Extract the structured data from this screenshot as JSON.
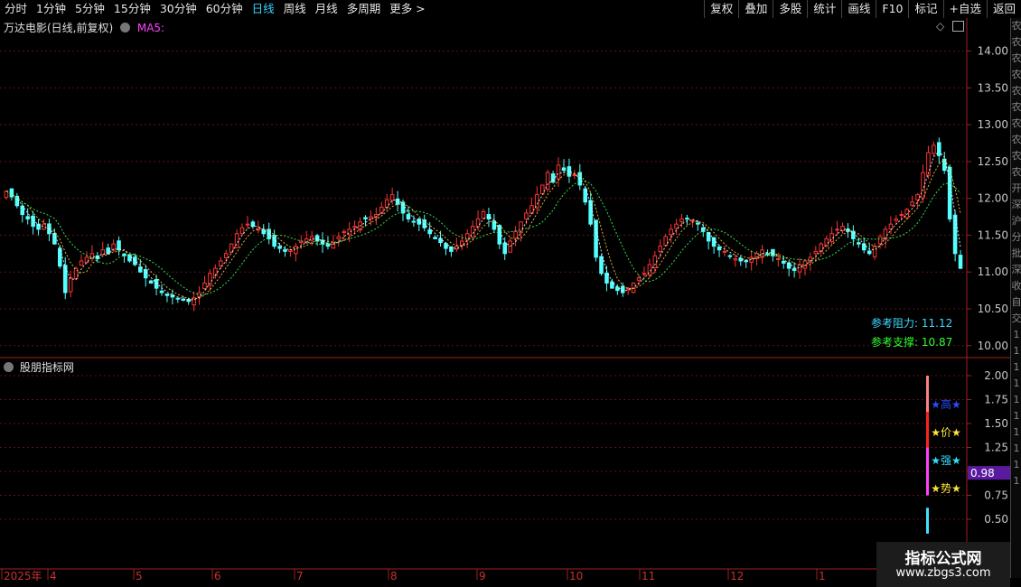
{
  "toolbar": {
    "periods": [
      "分时",
      "1分钟",
      "5分钟",
      "15分钟",
      "30分钟",
      "60分钟",
      "日线",
      "周线",
      "月线",
      "多周期",
      "更多 >"
    ],
    "active_period": "日线",
    "buttons": [
      "复权",
      "叠加",
      "多股",
      "统计",
      "画线",
      "F10",
      "标记",
      "+自选",
      "返回"
    ]
  },
  "side_strip": [
    "农",
    "农",
    "农",
    "农",
    "农",
    "农",
    "农",
    "农",
    "农",
    "农",
    "开",
    "深",
    "沪",
    "分",
    "批",
    "深",
    "收",
    "自",
    "交",
    "1",
    "1",
    "1",
    "1",
    "1",
    "1",
    "1",
    "1",
    "1",
    "1"
  ],
  "main_panel": {
    "title": "万达电影(日线,前复权)",
    "indicator": "MA5:",
    "price_ticks": [
      "14.00",
      "13.50",
      "13.00",
      "12.50",
      "12.00",
      "11.50",
      "11.00",
      "10.50",
      "10.00"
    ],
    "resistance_label": "参考阻力:",
    "resistance_value": "11.12",
    "support_label": "参考支撑:",
    "support_value": "10.87"
  },
  "sub_panel": {
    "title": "股朋指标网",
    "ticks": [
      "2.00",
      "1.75",
      "1.50",
      "1.25",
      "1.00",
      "0.75",
      "0.50"
    ],
    "labels": [
      {
        "text": "★高★",
        "color": "#2a4bff"
      },
      {
        "text": "★价★",
        "color": "#ffe23a"
      },
      {
        "text": "★强★",
        "color": "#33e0ff"
      },
      {
        "text": "★势★",
        "color": "#ffe23a"
      }
    ],
    "current_value": "0.98"
  },
  "time_axis": [
    "2025年",
    "4",
    "5",
    "6",
    "7",
    "8",
    "9",
    "10",
    "11",
    "12",
    "1"
  ],
  "watermark": {
    "line1": "指标公式网",
    "line2": "www.zbgs3.com"
  },
  "chart_data": {
    "type": "candlestick",
    "ylim": [
      9.85,
      14.3
    ],
    "colors": {
      "up": "#ff3232",
      "down": "#54ffff"
    },
    "close_series": [
      12.1,
      12.02,
      11.9,
      11.78,
      11.72,
      11.62,
      11.58,
      11.65,
      11.52,
      11.38,
      11.08,
      10.72,
      10.92,
      11.05,
      11.15,
      11.2,
      11.25,
      11.18,
      11.3,
      11.25,
      11.38,
      11.3,
      11.22,
      11.15,
      11.1,
      11.0,
      10.92,
      10.85,
      10.78,
      10.72,
      10.68,
      10.66,
      10.64,
      10.62,
      10.6,
      10.65,
      10.72,
      10.85,
      10.98,
      11.05,
      11.15,
      11.25,
      11.38,
      11.52,
      11.6,
      11.65,
      11.62,
      11.58,
      11.52,
      11.45,
      11.35,
      11.32,
      11.28,
      11.3,
      11.35,
      11.42,
      11.45,
      11.48,
      11.42,
      11.38,
      11.35,
      11.4,
      11.48,
      11.55,
      11.58,
      11.62,
      11.68,
      11.72,
      11.75,
      11.78,
      11.88,
      11.98,
      12.05,
      11.92,
      11.8,
      11.72,
      11.68,
      11.65,
      11.6,
      11.52,
      11.45,
      11.4,
      11.32,
      11.28,
      11.35,
      11.42,
      11.52,
      11.62,
      11.72,
      11.82,
      11.72,
      11.58,
      11.38,
      11.25,
      11.42,
      11.55,
      11.68,
      11.8,
      11.9,
      12.05,
      12.18,
      12.35,
      12.22,
      12.45,
      12.38,
      12.3,
      12.32,
      12.18,
      11.95,
      11.65,
      11.2,
      10.98,
      10.85,
      10.78,
      10.75,
      10.72,
      10.78,
      10.85,
      10.92,
      10.98,
      11.1,
      11.22,
      11.35,
      11.48,
      11.58,
      11.65,
      11.72,
      11.72,
      11.7,
      11.65,
      11.55,
      11.42,
      11.35,
      11.3,
      11.28,
      11.22,
      11.18,
      11.15,
      11.15,
      11.2,
      11.25,
      11.3,
      11.25,
      11.22,
      11.18,
      11.12,
      11.05,
      11.02,
      11.1,
      11.15,
      11.2,
      11.28,
      11.38,
      11.45,
      11.52,
      11.58,
      11.62,
      11.55,
      11.45,
      11.38,
      11.3,
      11.25,
      11.35,
      11.48,
      11.58,
      11.65,
      11.72,
      11.78,
      11.85,
      11.95,
      12.05,
      12.35,
      12.62,
      12.72,
      12.58,
      12.38,
      11.72,
      11.25,
      11.05
    ]
  }
}
